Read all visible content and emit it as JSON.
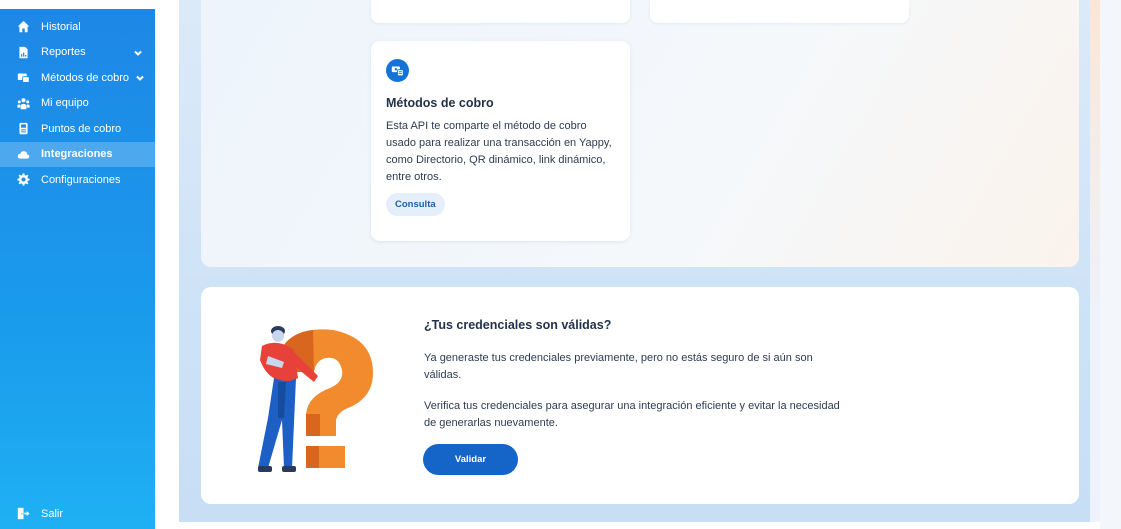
{
  "sidebar": {
    "items": [
      {
        "label": "Historial",
        "icon": "home-icon"
      },
      {
        "label": "Reportes",
        "icon": "report-icon",
        "has_chevron": true
      },
      {
        "label": "Métodos de cobro",
        "icon": "payment-methods-icon",
        "has_chevron": true
      },
      {
        "label": "Mi equipo",
        "icon": "team-icon"
      },
      {
        "label": "Puntos de cobro",
        "icon": "pos-icon"
      },
      {
        "label": "Integraciones",
        "icon": "cloud-icon",
        "active": true
      },
      {
        "label": "Configuraciones",
        "icon": "gear-icon"
      }
    ],
    "logout_label": "Salir"
  },
  "api_card": {
    "icon": "payment-method-icon",
    "title": "Métodos de cobro",
    "description": "Esta API te comparte el método de cobro usado para realizar una transacción en Yappy, como Directorio, QR dinámico, link dinámico, entre otros.",
    "action_label": "Consulta"
  },
  "credentials": {
    "title": "¿Tus credenciales son válidas?",
    "paragraph_1": "Ya generaste tus credenciales previamente, pero no estás seguro de si aún son válidas.",
    "paragraph_2": "Verifica tus credenciales para asegurar una integración eficiente y evitar la necesidad de generarlas nuevamente.",
    "button_label": "Validar"
  },
  "colors": {
    "sidebar_top": "#1e87e6",
    "sidebar_bottom": "#1fb0f3",
    "primary_button": "#1565c8",
    "illustration_orange": "#f28a2e"
  }
}
